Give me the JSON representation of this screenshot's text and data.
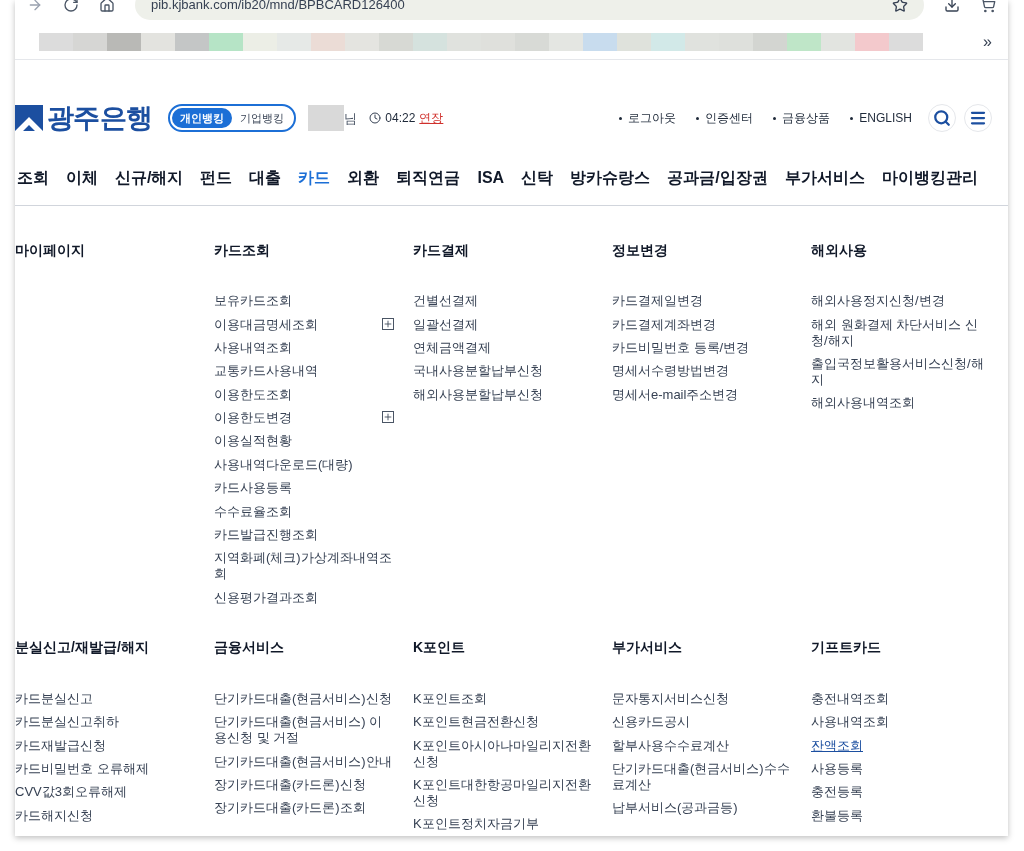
{
  "browser": {
    "address": "pib.kjbank.com/ib20/mnd/BPBCARD126400",
    "more": "»"
  },
  "header": {
    "logo": "광주은행",
    "banking_tabs": [
      {
        "label": "개인뱅킹",
        "selected": true
      },
      {
        "label": "기업뱅킹",
        "selected": false
      }
    ],
    "greeting": "님",
    "timer": "04:22",
    "extend": "연장",
    "links": [
      "로그아웃",
      "인증센터",
      "금융상품",
      "ENGLISH"
    ]
  },
  "nav": [
    {
      "label": "조회",
      "selected": false
    },
    {
      "label": "이체",
      "selected": false
    },
    {
      "label": "신규/해지",
      "selected": false
    },
    {
      "label": "펀드",
      "selected": false
    },
    {
      "label": "대출",
      "selected": false
    },
    {
      "label": "카드",
      "selected": true
    },
    {
      "label": "외환",
      "selected": false
    },
    {
      "label": "퇴직연금",
      "selected": false
    },
    {
      "label": "ISA",
      "selected": false
    },
    {
      "label": "신탁",
      "selected": false
    },
    {
      "label": "방카슈랑스",
      "selected": false
    },
    {
      "label": "공과금/입장권",
      "selected": false
    },
    {
      "label": "부가서비스",
      "selected": false
    },
    {
      "label": "마이뱅킹관리",
      "selected": false
    }
  ],
  "menu_rows": [
    [
      {
        "title": "마이페이지"
      },
      {
        "title": "카드조회",
        "items": [
          {
            "label": "보유카드조회",
            "expandable": false,
            "highlighted": false
          },
          {
            "label": "이용대금명세조회",
            "expandable": true,
            "highlighted": false
          },
          {
            "label": "사용내역조회",
            "expandable": false,
            "highlighted": false
          },
          {
            "label": "교통카드사용내역",
            "expandable": false,
            "highlighted": false
          },
          {
            "label": "이용한도조회",
            "expandable": false,
            "highlighted": false
          },
          {
            "label": "이용한도변경",
            "expandable": true,
            "highlighted": false
          },
          {
            "label": "이용실적현황",
            "expandable": false,
            "highlighted": false
          },
          {
            "label": "사용내역다운로드(대량)",
            "expandable": false,
            "highlighted": false
          },
          {
            "label": "카드사용등록",
            "expandable": false,
            "highlighted": false
          },
          {
            "label": "수수료율조회",
            "expandable": false,
            "highlighted": false
          },
          {
            "label": "카드발급진행조회",
            "expandable": false,
            "highlighted": false
          },
          {
            "label": "지역화폐(체크)가상계좌내역조회",
            "expandable": false,
            "highlighted": false
          },
          {
            "label": "신용평가결과조회",
            "expandable": false,
            "highlighted": false
          }
        ]
      },
      {
        "title": "카드결제",
        "items": [
          {
            "label": "건별선결제",
            "expandable": false,
            "highlighted": false
          },
          {
            "label": "일괄선결제",
            "expandable": false,
            "highlighted": false
          },
          {
            "label": "연체금액결제",
            "expandable": false,
            "highlighted": false
          },
          {
            "label": "국내사용분할납부신청",
            "expandable": false,
            "highlighted": false
          },
          {
            "label": "해외사용분할납부신청",
            "expandable": false,
            "highlighted": false
          }
        ]
      },
      {
        "title": "정보변경",
        "items": [
          {
            "label": "카드결제일변경",
            "expandable": false,
            "highlighted": false
          },
          {
            "label": "카드결제계좌변경",
            "expandable": false,
            "highlighted": false
          },
          {
            "label": "카드비밀번호 등록/변경",
            "expandable": false,
            "highlighted": false
          },
          {
            "label": "명세서수령방법변경",
            "expandable": false,
            "highlighted": false
          },
          {
            "label": "명세서e-mail주소변경",
            "expandable": false,
            "highlighted": false
          }
        ]
      },
      {
        "title": "해외사용",
        "items": [
          {
            "label": "해외사용정지신청/변경",
            "expandable": false,
            "highlighted": false
          },
          {
            "label": "해외 원화결제 차단서비스 신청/해지",
            "expandable": false,
            "highlighted": false
          },
          {
            "label": "출입국정보활용서비스신청/해지",
            "expandable": false,
            "highlighted": false
          },
          {
            "label": "해외사용내역조회",
            "expandable": false,
            "highlighted": false
          }
        ]
      }
    ],
    [
      {
        "title": "분실신고/재발급/해지",
        "items": [
          {
            "label": "카드분실신고",
            "expandable": false,
            "highlighted": false
          },
          {
            "label": "카드분실신고취하",
            "expandable": false,
            "highlighted": false
          },
          {
            "label": "카드재발급신청",
            "expandable": false,
            "highlighted": false
          },
          {
            "label": "카드비밀번호 오류해제",
            "expandable": false,
            "highlighted": false
          },
          {
            "label": "CVV값3회오류해제",
            "expandable": false,
            "highlighted": false
          },
          {
            "label": "카드해지신청",
            "expandable": false,
            "highlighted": false
          }
        ]
      },
      {
        "title": "금융서비스",
        "items": [
          {
            "label": "단기카드대출(현금서비스)신청",
            "expandable": false,
            "highlighted": false
          },
          {
            "label": "단기카드대출(현금서비스) 이용신청 및 거절",
            "expandable": false,
            "highlighted": false
          },
          {
            "label": "단기카드대출(현금서비스)안내",
            "expandable": false,
            "highlighted": false
          },
          {
            "label": "장기카드대출(카드론)신청",
            "expandable": false,
            "highlighted": false
          },
          {
            "label": "장기카드대출(카드론)조회",
            "expandable": false,
            "highlighted": false
          }
        ]
      },
      {
        "title": "K포인트",
        "items": [
          {
            "label": "K포인트조회",
            "expandable": false,
            "highlighted": false
          },
          {
            "label": "K포인트현금전환신청",
            "expandable": false,
            "highlighted": false
          },
          {
            "label": "K포인트아시아나마일리지전환신청",
            "expandable": false,
            "highlighted": false
          },
          {
            "label": "K포인트대한항공마일리지전환신청",
            "expandable": false,
            "highlighted": false
          },
          {
            "label": "K포인트정치자금기부",
            "expandable": false,
            "highlighted": false
          }
        ]
      },
      {
        "title": "부가서비스",
        "items": [
          {
            "label": "문자통지서비스신청",
            "expandable": false,
            "highlighted": false
          },
          {
            "label": "신용카드공시",
            "expandable": false,
            "highlighted": false
          },
          {
            "label": "할부사용수수료계산",
            "expandable": false,
            "highlighted": false
          },
          {
            "label": "단기카드대출(현금서비스)수수료계산",
            "expandable": false,
            "highlighted": false
          },
          {
            "label": "납부서비스(공과금등)",
            "expandable": false,
            "highlighted": false
          }
        ]
      },
      {
        "title": "기프트카드",
        "items": [
          {
            "label": "충전내역조회",
            "expandable": false,
            "highlighted": false
          },
          {
            "label": "사용내역조회",
            "expandable": false,
            "highlighted": false
          },
          {
            "label": "잔액조회",
            "expandable": false,
            "highlighted": true
          },
          {
            "label": "사용등록",
            "expandable": false,
            "highlighted": false
          },
          {
            "label": "충전등록",
            "expandable": false,
            "highlighted": false
          },
          {
            "label": "환불등록",
            "expandable": false,
            "highlighted": false
          }
        ]
      }
    ]
  ]
}
